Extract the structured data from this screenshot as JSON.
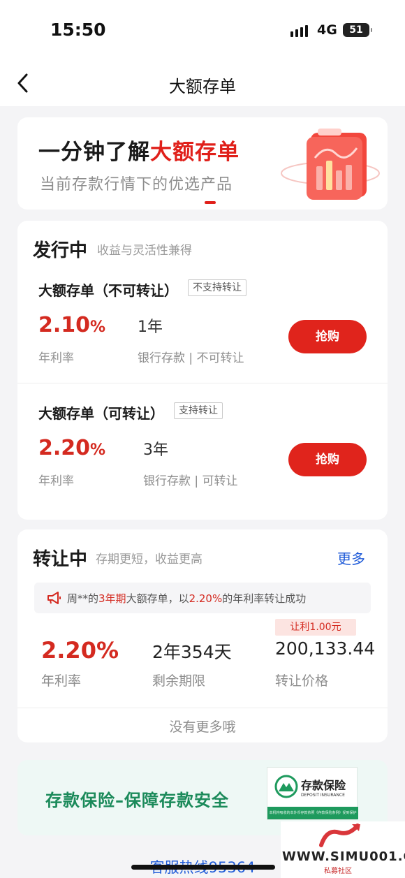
{
  "status_bar": {
    "time": "15:50",
    "network": "4G",
    "battery": "51"
  },
  "nav": {
    "title": "大额存单"
  },
  "banner": {
    "headline_prefix": "一分钟了解",
    "headline_highlight": "大额存单",
    "subtitle": "当前存款行情下的优选产品",
    "accent_color": "#e0201a"
  },
  "issuing": {
    "title": "发行中",
    "subtitle": "收益与灵活性兼得",
    "products": [
      {
        "name": "大额存单（不可转让）",
        "tag": "不支持转让",
        "rate": "2.10",
        "rate_unit": "%",
        "rate_label": "年利率",
        "term": "1年",
        "term_label": "银行存款 | 不可转让",
        "button": "抢购"
      },
      {
        "name": "大额存单（可转让）",
        "tag": "支持转让",
        "rate": "2.20",
        "rate_unit": "%",
        "rate_label": "年利率",
        "term": "3年",
        "term_label": "银行存款 | 可转让",
        "button": "抢购"
      }
    ]
  },
  "transfer": {
    "title": "转让中",
    "subtitle": "存期更短，收益更高",
    "more": "更多",
    "notice": {
      "part1": "周**的",
      "term": "3年期",
      "part2": "大额存单，以",
      "rate": "2.20%",
      "part3": "的年利率转让成功"
    },
    "item": {
      "rate": "2.20%",
      "rate_label": "年利率",
      "remaining": "2年354天",
      "remaining_label": "剩余期限",
      "price": "200,133.44",
      "price_label": "转让价格",
      "discount": "让利1.00元"
    },
    "no_more": "没有更多哦"
  },
  "insurance": {
    "title": "存款保险–保障存款安全",
    "logo_cn": "存款保险",
    "logo_en": "DEPOSIT INSURANCE",
    "logo_bar": "本机构吸收的本外币存款依照《存款保险条例》受到保护"
  },
  "footer": {
    "hotline": "客服热线95364"
  },
  "watermark": {
    "url": "WWW.SIMU001.CN",
    "cn": "私募社区"
  },
  "colors": {
    "red": "#e0241c",
    "rate_red": "#d42a20",
    "link_blue": "#1f5bd8",
    "green": "#1b8a5a"
  }
}
